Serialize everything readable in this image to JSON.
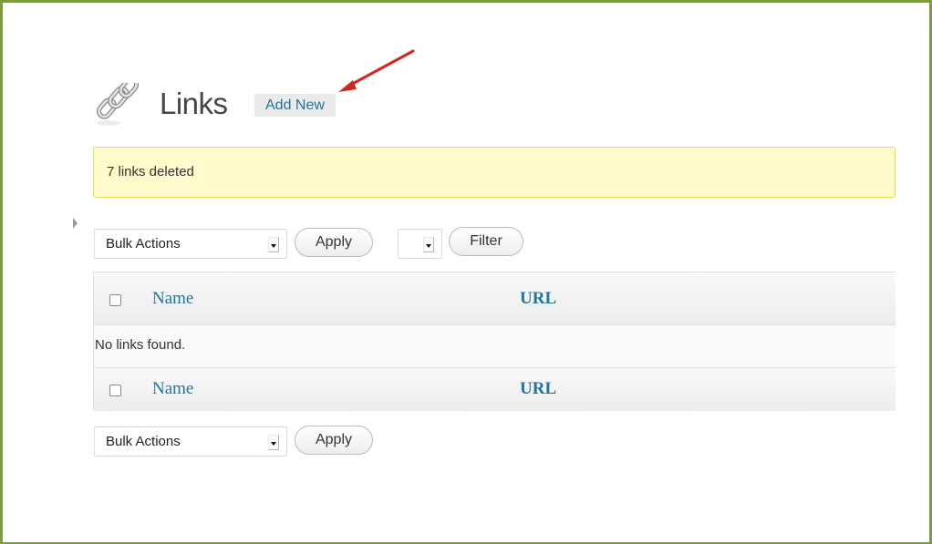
{
  "header": {
    "title": "Links",
    "add_new_label": "Add New",
    "icon": "links-icon"
  },
  "notice": {
    "text": "7 links deleted"
  },
  "top_nav": {
    "bulk_actions_label": "Bulk Actions",
    "apply_label": "Apply",
    "filter_select_label": "",
    "filter_label": "Filter"
  },
  "table": {
    "columns": [
      "Name",
      "URL"
    ],
    "empty_message": "No links found."
  },
  "bottom_nav": {
    "bulk_actions_label": "Bulk Actions",
    "apply_label": "Apply"
  },
  "colors": {
    "frame_border": "#7d9b3f",
    "link": "#21759b",
    "notice_bg": "#fffbcc",
    "notice_border": "#e6db55",
    "annotation_arrow": "#d0281d"
  }
}
